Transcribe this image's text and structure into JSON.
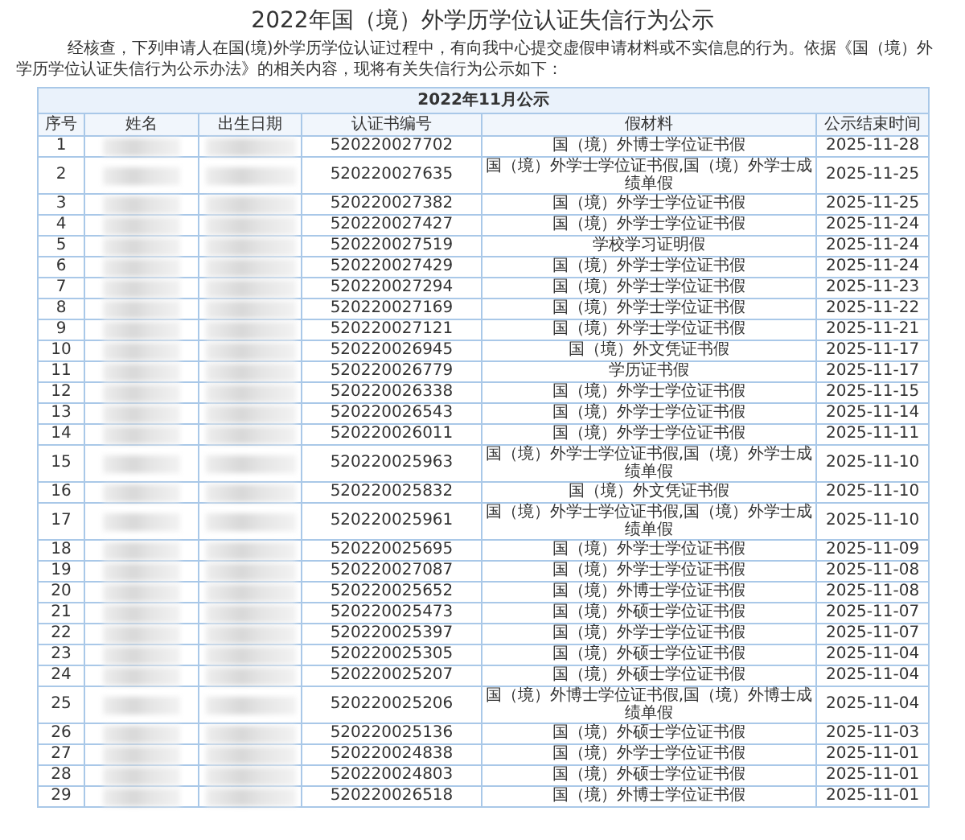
{
  "page": {
    "title": "2022年国（境）外学历学位认证失信行为公示",
    "intro": "经核查，下列申请人在国(境)外学历学位认证过程中，有向我中心提交虚假申请材料或不实信息的行为。依据《国（境）外学历学位认证失信行为公示办法》的相关内容，现将有关失信行为公示如下："
  },
  "table": {
    "caption": "2022年11月公示",
    "columns": [
      "序号",
      "姓名",
      "出生日期",
      "认证书编号",
      "假材料",
      "公示结束时间"
    ],
    "rows": [
      {
        "no": "1",
        "cert": "520220027702",
        "material": "国（境）外博士学位证书假",
        "end": "2025-11-28"
      },
      {
        "no": "2",
        "cert": "520220027635",
        "material": "国（境）外学士学位证书假,国（境）外学士成绩单假",
        "end": "2025-11-25"
      },
      {
        "no": "3",
        "cert": "520220027382",
        "material": "国（境）外学士学位证书假",
        "end": "2025-11-25"
      },
      {
        "no": "4",
        "cert": "520220027427",
        "material": "国（境）外学士学位证书假",
        "end": "2025-11-24"
      },
      {
        "no": "5",
        "cert": "520220027519",
        "material": "学校学习证明假",
        "end": "2025-11-24"
      },
      {
        "no": "6",
        "cert": "520220027429",
        "material": "国（境）外学士学位证书假",
        "end": "2025-11-24"
      },
      {
        "no": "7",
        "cert": "520220027294",
        "material": "国（境）外学士学位证书假",
        "end": "2025-11-23"
      },
      {
        "no": "8",
        "cert": "520220027169",
        "material": "国（境）外学士学位证书假",
        "end": "2025-11-22"
      },
      {
        "no": "9",
        "cert": "520220027121",
        "material": "国（境）外学士学位证书假",
        "end": "2025-11-21"
      },
      {
        "no": "10",
        "cert": "520220026945",
        "material": "国（境）外文凭证书假",
        "end": "2025-11-17"
      },
      {
        "no": "11",
        "cert": "520220026779",
        "material": "学历证书假",
        "end": "2025-11-17"
      },
      {
        "no": "12",
        "cert": "520220026338",
        "material": "国（境）外学士学位证书假",
        "end": "2025-11-15"
      },
      {
        "no": "13",
        "cert": "520220026543",
        "material": "国（境）外学士学位证书假",
        "end": "2025-11-14"
      },
      {
        "no": "14",
        "cert": "520220026011",
        "material": "国（境）外学士学位证书假",
        "end": "2025-11-11"
      },
      {
        "no": "15",
        "cert": "520220025963",
        "material": "国（境）外学士学位证书假,国（境）外学士成绩单假",
        "end": "2025-11-10"
      },
      {
        "no": "16",
        "cert": "520220025832",
        "material": "国（境）外文凭证书假",
        "end": "2025-11-10"
      },
      {
        "no": "17",
        "cert": "520220025961",
        "material": "国（境）外学士学位证书假,国（境）外学士成绩单假",
        "end": "2025-11-10"
      },
      {
        "no": "18",
        "cert": "520220025695",
        "material": "国（境）外学士学位证书假",
        "end": "2025-11-09"
      },
      {
        "no": "19",
        "cert": "520220027087",
        "material": "国（境）外学士学位证书假",
        "end": "2025-11-08"
      },
      {
        "no": "20",
        "cert": "520220025652",
        "material": "国（境）外博士学位证书假",
        "end": "2025-11-08"
      },
      {
        "no": "21",
        "cert": "520220025473",
        "material": "国（境）外硕士学位证书假",
        "end": "2025-11-07"
      },
      {
        "no": "22",
        "cert": "520220025397",
        "material": "国（境）外学士学位证书假",
        "end": "2025-11-07"
      },
      {
        "no": "23",
        "cert": "520220025305",
        "material": "国（境）外硕士学位证书假",
        "end": "2025-11-04"
      },
      {
        "no": "24",
        "cert": "520220025207",
        "material": "国（境）外硕士学位证书假",
        "end": "2025-11-04"
      },
      {
        "no": "25",
        "cert": "520220025206",
        "material": "国（境）外博士学位证书假,国（境）外博士成绩单假",
        "end": "2025-11-04"
      },
      {
        "no": "26",
        "cert": "520220025136",
        "material": "国（境）外硕士学位证书假",
        "end": "2025-11-03"
      },
      {
        "no": "27",
        "cert": "520220024838",
        "material": "国（境）外学士学位证书假",
        "end": "2025-11-01"
      },
      {
        "no": "28",
        "cert": "520220024803",
        "material": "国（境）外硕士学位证书假",
        "end": "2025-11-01"
      },
      {
        "no": "29",
        "cert": "520220026518",
        "material": "国（境）外博士学位证书假",
        "end": "2025-11-01"
      }
    ]
  }
}
